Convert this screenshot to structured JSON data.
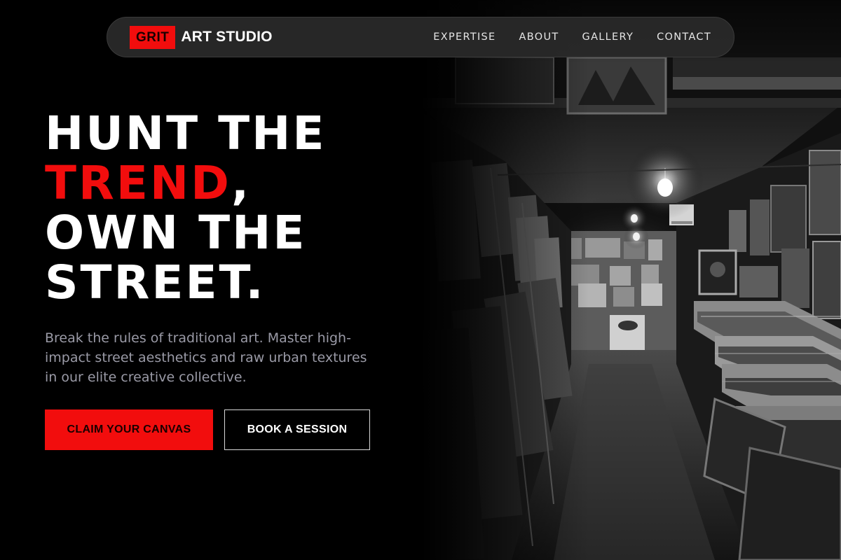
{
  "brand": {
    "tag": "GRIT",
    "name": "ART STUDIO",
    "accent_color": "#f20d0d"
  },
  "nav": {
    "items": [
      {
        "label": "EXPERTISE"
      },
      {
        "label": "ABOUT"
      },
      {
        "label": "GALLERY"
      },
      {
        "label": "CONTACT"
      }
    ]
  },
  "hero": {
    "headline": {
      "line1": "HUNT THE",
      "highlight": "TREND",
      "highlight_suffix": ",",
      "line3": "OWN THE",
      "line4": "STREET."
    },
    "description": "Break the rules of traditional art. Master high-impact street aesthetics and raw urban textures in our elite creative collective.",
    "primary_cta": "CLAIM YOUR CANVAS",
    "secondary_cta": "BOOK A SESSION"
  },
  "hero_image": {
    "subject": "black-and-white photo of a cramped art storage corridor"
  }
}
